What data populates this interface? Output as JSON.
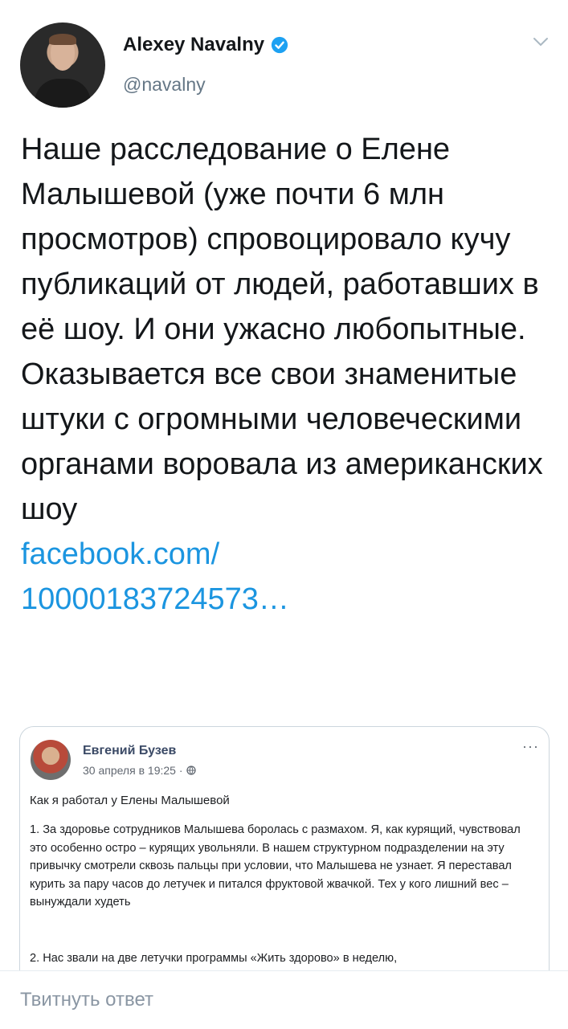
{
  "tweet": {
    "author_name": "Alexey Navalny",
    "author_handle": "@navalny",
    "text": "Наше расследование о Елене Малышевой (уже почти 6 млн просмотров) спровоцировало кучу публикаций от людей, работавших в её шоу. И они ужасно любопытные. Оказывается все свои знаменитые штуки с огромными человеческими органами воровала из американских шоу",
    "link_line1": "facebook.com/",
    "link_line2": "10000183724573…"
  },
  "embedded_post": {
    "author": "Евгений Бузев",
    "date": "30 апреля в 19:25 ·",
    "more": "···",
    "title": "Как я работал у Елены Малышевой",
    "paragraph1": "1. За здоровье сотрудников Малышева боролась с размахом. Я, как курящий, чувствовал это особенно остро – курящих увольняли. В нашем структурном подразделении на эту привычку смотрели сквозь пальцы при условии, что Малышева не узнает. Я переставал курить за пару часов до летучек и питался фруктовой жвачкой. Тех у кого лишний вес – вынуждали худеть",
    "paragraph2": "2. Нас звали на две летучки программы «Жить здорово» в неделю,"
  },
  "reply": {
    "placeholder": "Твитнуть ответ"
  },
  "colors": {
    "link": "#1b95e0",
    "verified": "#1da1f2",
    "secondary_text": "#657786"
  }
}
